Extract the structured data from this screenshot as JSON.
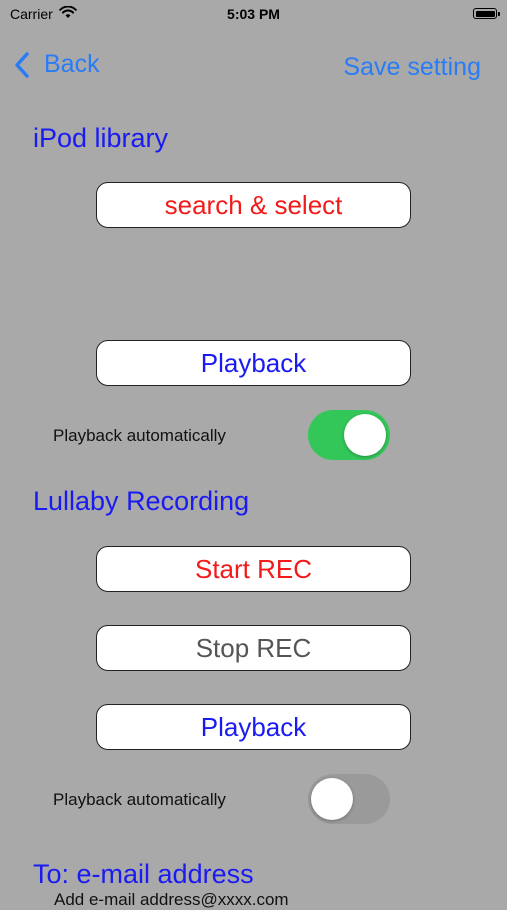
{
  "status": {
    "carrier": "Carrier",
    "time": "5:03 PM"
  },
  "nav": {
    "back_label": "Back",
    "save_label": "Save setting"
  },
  "ipod": {
    "heading": "iPod library",
    "search_label": "search & select",
    "playback_label": "Playback",
    "auto_label": "Playback automatically",
    "auto_on": true
  },
  "recording": {
    "heading": "Lullaby Recording",
    "start_label": "Start REC",
    "stop_label": "Stop REC",
    "playback_label": "Playback",
    "auto_label": "Playback automatically",
    "auto_on": false
  },
  "email": {
    "heading": "To: e-mail address",
    "partial_text": "Add e-mail address@xxxx.com"
  },
  "colors": {
    "background": "#a9a9a9",
    "link_blue": "#2a7cf6",
    "heading_blue": "#1a1af2",
    "red": "#f21b1b",
    "switch_on": "#33c759"
  }
}
